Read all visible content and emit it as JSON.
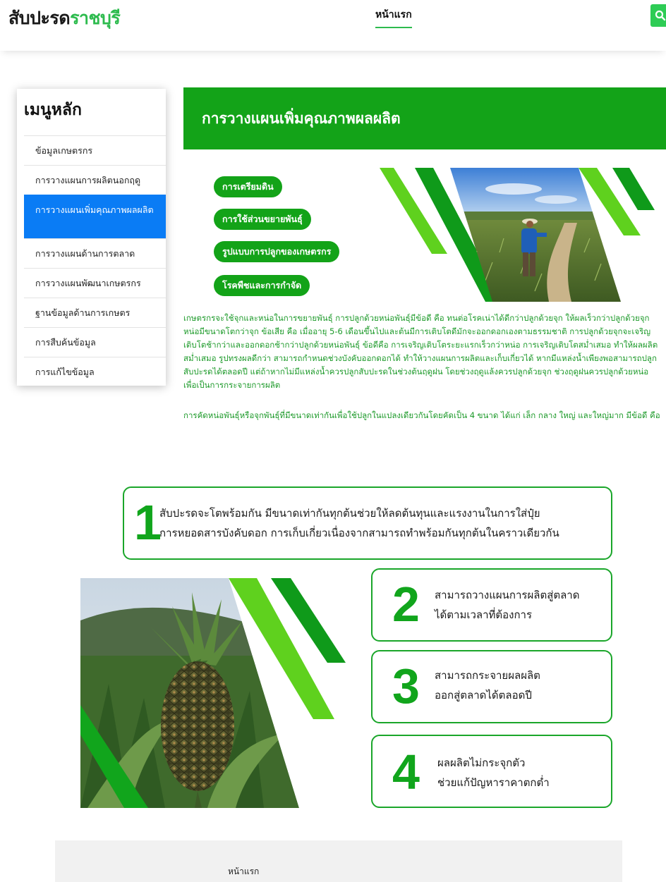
{
  "header": {
    "logo_part1": "สับปะรด",
    "logo_part2": "ราชบุรี",
    "nav_home": "หน้าแรก",
    "search_icon": "search-icon"
  },
  "sidebar": {
    "title": "เมนูหลัก",
    "items": [
      {
        "label": "ข้อมูลเกษตรกร",
        "active": false
      },
      {
        "label": "การวางแผนการผลิตนอกฤดู",
        "active": false
      },
      {
        "label": "การวางแผนเพิ่มคุณภาพผลผลิต",
        "active": true
      },
      {
        "label": "การวางแผนด้านการตลาด",
        "active": false
      },
      {
        "label": "การวางแผนพัฒนาเกษตรกร",
        "active": false
      },
      {
        "label": "ฐานข้อมูลด้านการเกษตร",
        "active": false
      },
      {
        "label": "การสืบค้นข้อมูล",
        "active": false
      },
      {
        "label": "การแก้ไขข้อมูล",
        "active": false
      }
    ]
  },
  "main": {
    "title": "การวางแผนเพิ่มคุณภาพผลผลิต",
    "pills": [
      "การเตรียมดิน",
      "การใช้ส่วนขยายพันธุ์",
      "รูปแบบการปลูกของเกษตรกร",
      "โรคพืชและการกำจัด"
    ],
    "paragraph1": "เกษตรกรจะใช้จุกและหน่อในการขยายพันธุ์ การปลูกด้วยหน่อพันธุ์มีข้อดี คือ ทนต่อโรคเน่าได้ดีกว่าปลูกด้วยจุก ให้ผลเร็วกว่าปลูกด้วยจุก หน่อมีขนาดโตกว่าจุก ข้อเสีย คือ เมื่ออายุ 5-6 เดือนขึ้นไปและต้นมีการเติบโตดีมักจะออกดอกเองตามธรรมชาติ การปลูกด้วยจุกจะเจริญเติบโตช้ากว่าและออกดอกช้ากว่าปลูกด้วยหน่อพันธุ์ ข้อดีคือ การเจริญเติบโตระยะแรกเร็วกว่าหน่อ การเจริญเติบโตสม่ำเสมอ ทำให้ผลผลิตสม่ำเสมอ รูปทรงผลดีกว่า สามารถกำหนดช่วงบังคับออกดอกได้ ทำให้วางแผนการผลิตและเก็บเกี่ยวได้ หากมีแหล่งน้ำเพียงพอสามารถปลูกสับปะรดได้ตลอดปี แต่ถ้าหากไม่มีแหล่งน้ำควรปลูกสับปะรดในช่วงต้นฤดูฝน โดยช่วงฤดูแล้งควรปลูกด้วยจุก ช่วงฤดูฝนควรปลูกด้วยหน่อเพื่อเป็นการกระจายการผลิต",
    "paragraph2": "การคัดหน่อพันธุ์หรือจุกพันธุ์ที่มีขนาดเท่ากันเพื่อใช้ปลูกในแปลงเดียวกันโดยคัดเป็น 4 ขนาด ได้แก่ เล็ก กลาง ใหญ่ และใหญ่มาก มีข้อดี คือ"
  },
  "benefits": [
    {
      "number": "1",
      "line1": "สับปะรดจะโตพร้อมกัน มีขนาดเท่ากันทุกต้นช่วยให้ลดต้นทุนและแรงงานในการใส่ปุ๋ย",
      "line2": "การหยอดสารบังคับดอก การเก็บเกี่ยวเนื่องจากสามารถทำพร้อมกันทุกต้นในคราวเดียวกัน"
    },
    {
      "number": "2",
      "line1": "สามารถวางแผนการผลิตสู่ตลาด",
      "line2": "ได้ตามเวลาที่ต้องการ"
    },
    {
      "number": "3",
      "line1": "สามารถกระจายผลผลิต",
      "line2": "ออกสู่ตลาดได้ตลอดปี"
    },
    {
      "number": "4",
      "line1": "ผลผลิตไม่กระจุกตัว",
      "line2": "ช่วยแก้ปัญหาราคาตกต่ำ"
    }
  ],
  "footer": {
    "home_link": "หน้าแรก"
  },
  "colors": {
    "brand_green": "#13a318",
    "accent_green": "#2dbb4e",
    "active_blue": "#0a7cf5",
    "text_green": "#1d9a2a"
  }
}
